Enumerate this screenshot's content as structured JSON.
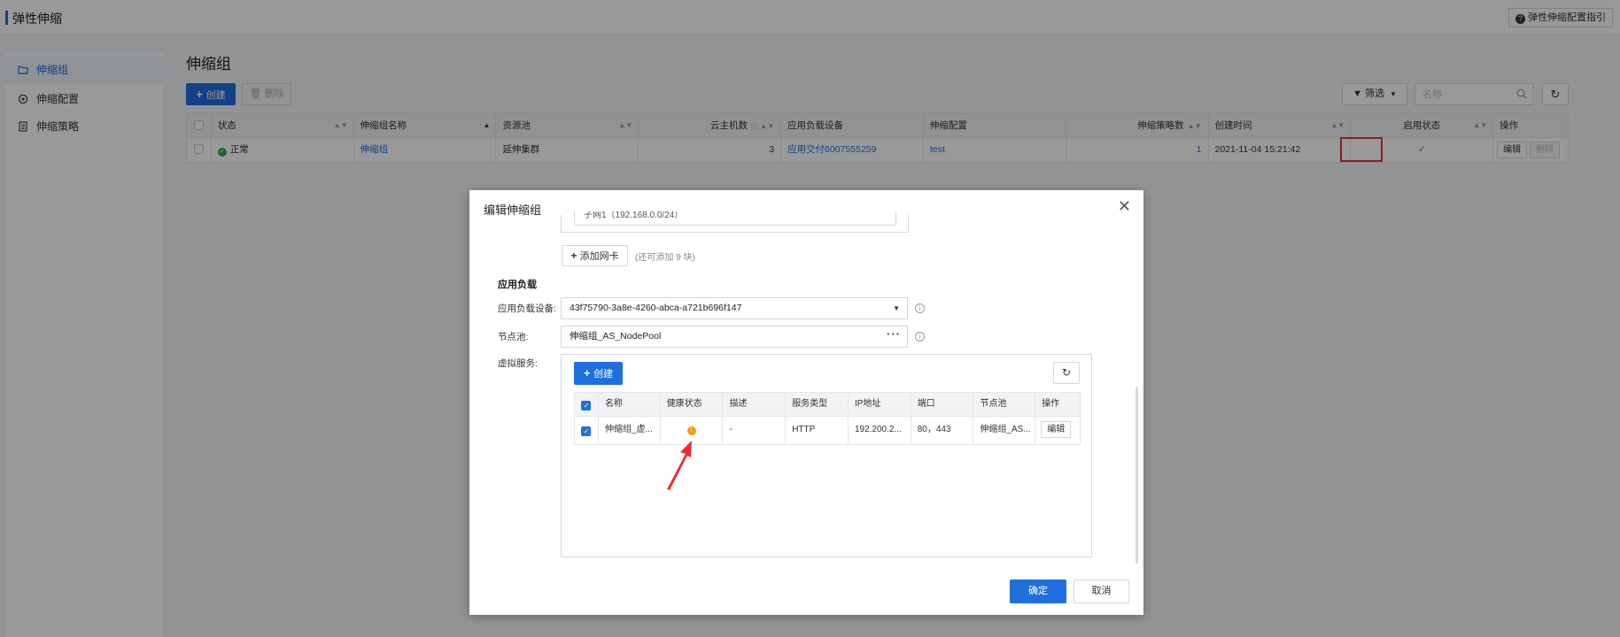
{
  "topbar": {
    "title": "弹性伸缩",
    "guide_label": "弹性伸缩配置指引"
  },
  "sidebar": {
    "items": [
      {
        "label": "伸缩组",
        "icon": "folder-icon",
        "active": true
      },
      {
        "label": "伸缩配置",
        "icon": "gear-icon",
        "active": false
      },
      {
        "label": "伸缩策略",
        "icon": "document-icon",
        "active": false
      }
    ]
  },
  "main": {
    "title": "伸缩组",
    "create_label": "创建",
    "delete_label": "删除",
    "filter_label": "筛选",
    "search_placeholder": "名称",
    "table": {
      "headers": [
        "状态",
        "伸缩组名称",
        "资源池",
        "云主机数",
        "应用负载设备",
        "伸缩配置",
        "伸缩策略数",
        "创建时间",
        "启用状态",
        "操作"
      ],
      "rows": [
        {
          "status": "正常",
          "name": "伸缩组",
          "pool": "延伸集群",
          "hosts": "3",
          "lb_device": "应用交付6007555259",
          "config": "test",
          "policies": "1",
          "created": "2021-11-04 15:21:42",
          "enabled": "✓",
          "edit_label": "编辑",
          "delete_label": "删除"
        }
      ]
    }
  },
  "modal": {
    "title": "编辑伸缩组",
    "nic_partial": "子网1（192.168.0.0/24）",
    "add_nic_label": "添加网卡",
    "add_nic_hint": "(还可添加 9 块)",
    "section_title": "应用负载",
    "lb_device_label": "应用负载设备:",
    "lb_device_value": "43f75790-3a8e-4260-abca-a721b696f147",
    "node_pool_label": "节点池:",
    "node_pool_value": "伸缩组_AS_NodePool",
    "virtual_service_label": "虚拟服务:",
    "vs_create_label": "创建",
    "vs_table": {
      "headers": [
        "名称",
        "健康状态",
        "描述",
        "服务类型",
        "IP地址",
        "端口",
        "节点池",
        "操作"
      ],
      "rows": [
        {
          "name": "伸缩组_虚...",
          "health": "!",
          "description": "-",
          "type": "HTTP",
          "ip": "192.200.2...",
          "port": "80，443",
          "node_pool": "伸缩组_AS...",
          "edit_label": "编辑"
        }
      ]
    },
    "confirm_label": "确定",
    "cancel_label": "取消"
  },
  "colors": {
    "primary": "#1f6fde",
    "success": "#2fa84f",
    "warning": "#f29a1a",
    "highlight": "#e63434"
  }
}
